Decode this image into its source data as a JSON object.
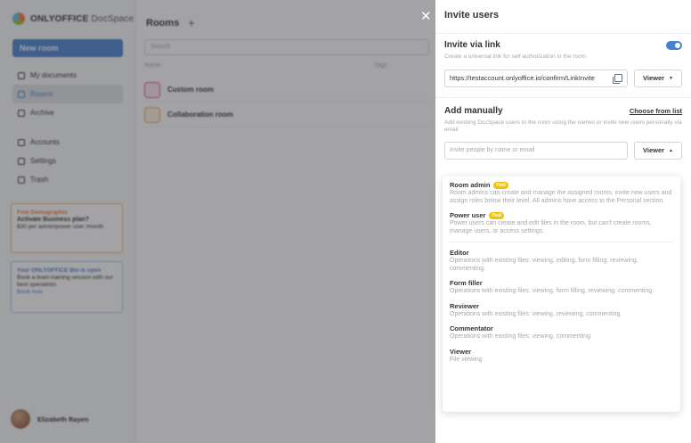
{
  "app": {
    "logo_brand": "ONLYOFFICE",
    "logo_product": "DocSpace",
    "new_room_label": "New room",
    "nav": [
      {
        "label": "My documents"
      },
      {
        "label": "Rooms"
      },
      {
        "label": "Archive"
      },
      {
        "label": "Accounts"
      },
      {
        "label": "Settings"
      },
      {
        "label": "Trash"
      }
    ],
    "promo_business": {
      "line1": "Free Demographic",
      "line2": "Activate Business plan?",
      "line3": "$30 per admin/power user /month"
    },
    "promo_training": {
      "line1": "Your ONLYOFFICE Bio is open",
      "line2": "Book a team training session with our best specialists",
      "link": "Book now"
    },
    "user_name": "Elizabeth Rayen",
    "main_title": "Rooms",
    "search_placeholder": "Search",
    "table_headers": [
      "Name",
      "Tags"
    ],
    "rooms": [
      {
        "name": "Custom room",
        "color": "#e84e8a"
      },
      {
        "name": "Collaboration room",
        "color": "#f7a14a"
      }
    ]
  },
  "close_icon": "close-icon",
  "panel": {
    "title": "Invite users",
    "via_link": {
      "title": "Invite via link",
      "description": "Create a universal link for self authorization in the room",
      "link_value": "https://testaccount.onlyoffice.io/confirm/LinkInvite",
      "role": "Viewer",
      "enabled": true
    },
    "manually": {
      "title": "Add manually",
      "choose_from_list": "Choose from list",
      "description": "Add existing DocSpace users to the room using the names or invite new users personally via email",
      "input_placeholder": "Invite people by name or email",
      "role": "Viewer"
    },
    "roles_menu": [
      {
        "title": "Room admin",
        "paid": "Paid",
        "description": "Room admins can create and manage the assigned rooms, invite new users and assign roles below their level. All admins have access to the Personal section."
      },
      {
        "title": "Power user",
        "paid": "Paid",
        "description": "Power users can create and edit files in the room, but can't create rooms, manage users, or access settings."
      },
      {
        "title": "Editor",
        "description": "Operations with existing files: viewing, editing, form filling, reviewing, commenting."
      },
      {
        "title": "Form filler",
        "description": "Operations with existing files: viewing, form filling, reviewing, commenting."
      },
      {
        "title": "Reviewer",
        "description": "Operations with existing files: viewing, reviewing, commenting."
      },
      {
        "title": "Commentator",
        "description": "Operations with existing files: viewing, commenting."
      },
      {
        "title": "Viewer",
        "description": "File viewing"
      }
    ]
  },
  "colors": {
    "accent": "#4781d1",
    "paid_badge": "#edc409"
  }
}
